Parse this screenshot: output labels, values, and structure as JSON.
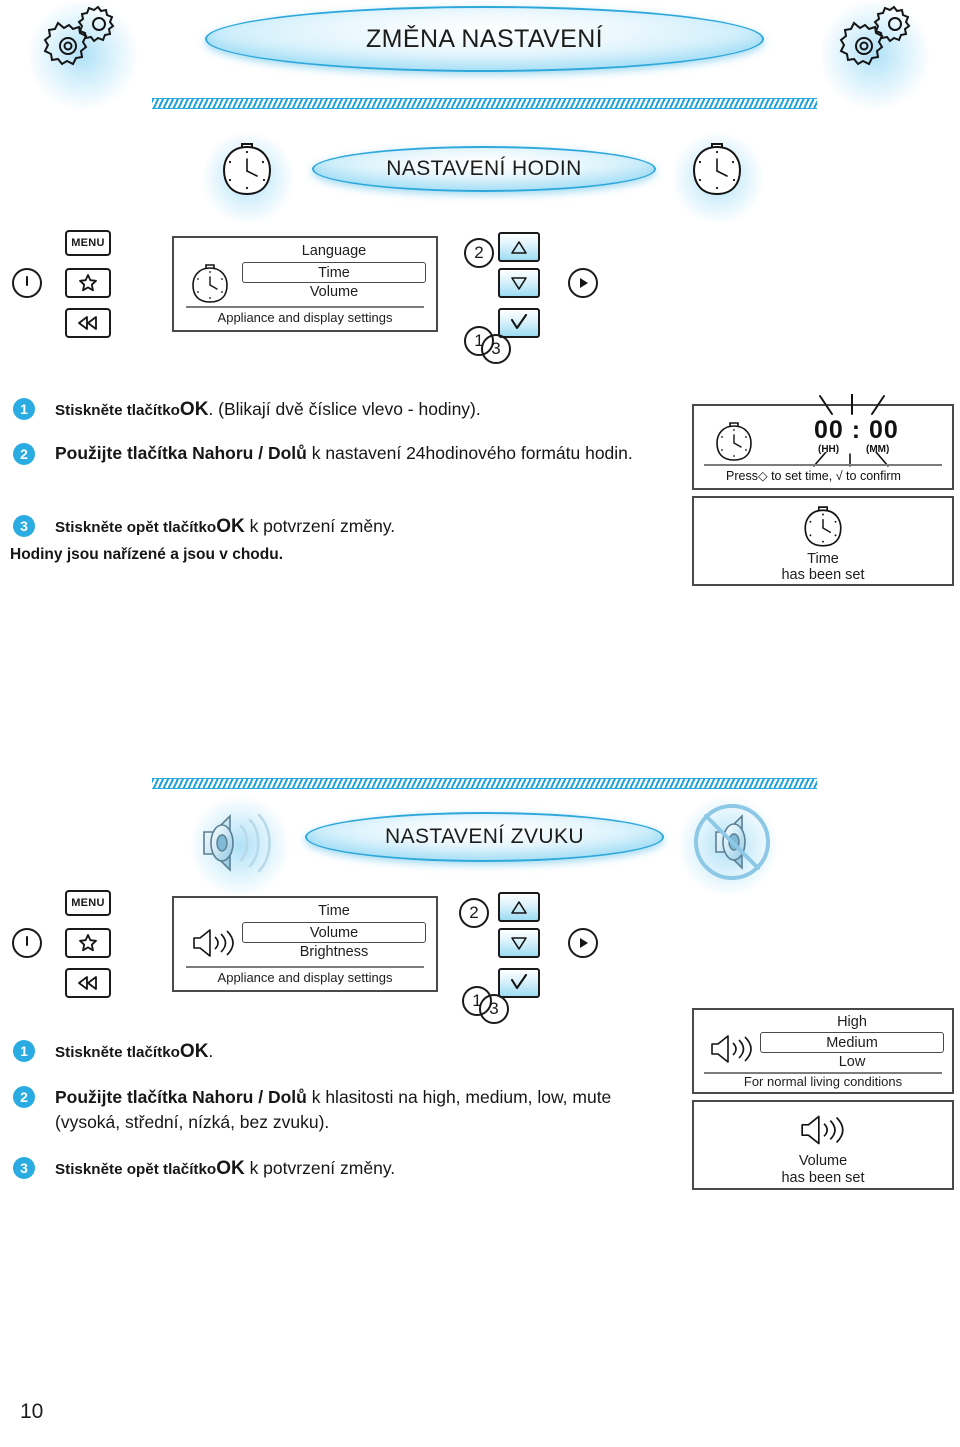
{
  "page": {
    "number": "10"
  },
  "colors": {
    "accent": "#2aabe2",
    "oval_border": "#2ea8db",
    "hatch": "#1aa3dd",
    "screen_border": "#4a4a4a"
  },
  "section_settings": {
    "title": "ZMĚNA NASTAVENÍ",
    "left_icon": "gears-icon",
    "right_icon": "gears-icon"
  },
  "section_clock": {
    "title": "NASTAVENÍ HODIN",
    "left_icon": "clock-icon",
    "right_icon": "clock-icon",
    "controls": {
      "power_icon": "power-icon",
      "menu_label": "MENU",
      "favourite_icon": "star-icon",
      "back_icon": "rewind-icon",
      "up_icon": "triangle-up-icon",
      "down_icon": "triangle-down-icon",
      "confirm_icon": "checkmark-icon",
      "play_icon": "play-icon",
      "step_up": "2",
      "step_confirm_a": "1",
      "step_confirm_b": "3"
    },
    "menu_screen": {
      "icon": "clock-icon",
      "items": [
        "Language",
        "Time",
        "Volume"
      ],
      "selected": "Time",
      "footer": "Appliance and display settings"
    },
    "steps": [
      {
        "num": "1",
        "lead": "Stiskněte tlačítko",
        "lead_sc": "S",
        "key": "OK",
        "rest": ". (Blikají dvě číslice vlevo - hodiny)."
      },
      {
        "num": "2",
        "lead": "Použijte tlačítka Nahoru / Dolů",
        "key": "",
        "rest": "  k nastavení 24hodinového formátu hodin."
      },
      {
        "num": "3",
        "lead": "Stiskněte opět tlačítko",
        "key": "OK",
        "rest": " k potvrzení změny."
      }
    ],
    "note": "Hodiny jsou nařízené a jsou v chodu.",
    "display_set": {
      "icon": "clock-icon",
      "time_value": "00 : 00",
      "hh_label": "(HH)",
      "mm_label": "(MM)",
      "hint_prefix": "Press",
      "hint_arrows_icon": "updown-arrows-icon",
      "hint_middle": "to set time,",
      "hint_check_icon": "checkmark-icon",
      "hint_suffix": "to confirm"
    },
    "display_done": {
      "icon": "clock-icon",
      "line1": "Time",
      "line2": "has been set"
    }
  },
  "section_sound": {
    "title": "NASTAVENÍ ZVUKU",
    "left_icon": "speaker-on-icon",
    "right_icon": "speaker-muted-icon",
    "controls": {
      "power_icon": "power-icon",
      "menu_label": "MENU",
      "favourite_icon": "star-icon",
      "back_icon": "rewind-icon",
      "up_icon": "triangle-up-icon",
      "down_icon": "triangle-down-icon",
      "confirm_icon": "checkmark-icon",
      "play_icon": "play-icon",
      "step_up": "2",
      "step_confirm_a": "1",
      "step_confirm_b": "3"
    },
    "menu_screen": {
      "icon": "speaker-icon",
      "items": [
        "Time",
        "Volume",
        "Brightness"
      ],
      "selected": "Volume",
      "footer": "Appliance and display settings"
    },
    "steps": [
      {
        "num": "1",
        "lead": "Stiskněte tlačítko",
        "key": "OK",
        "rest": "."
      },
      {
        "num": "2",
        "lead": "Použijte tlačítka Nahoru / Dolů",
        "key": "",
        "rest": " k hlasitosti na high, medium, low, mute (vysoká, střední, nízká, bez zvuku)."
      },
      {
        "num": "3",
        "lead": "Stiskněte opět tlačítko",
        "key": "OK",
        "rest": " k potvrzení změny."
      }
    ],
    "display_levels": {
      "icon": "speaker-icon",
      "items": [
        "High",
        "Medium",
        "Low"
      ],
      "selected": "Medium",
      "footer": "For normal living conditions"
    },
    "display_done": {
      "icon": "speaker-icon",
      "line1": "Volume",
      "line2": "has been set"
    }
  }
}
